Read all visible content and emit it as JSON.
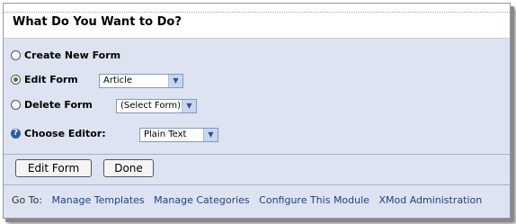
{
  "header": {
    "title": "What Do You Want to Do?"
  },
  "options": {
    "create": {
      "label": "Create New Form",
      "checked": false
    },
    "edit": {
      "label": "Edit Form",
      "checked": true,
      "select_value": "Article"
    },
    "delete": {
      "label": "Delete Form",
      "checked": false,
      "select_value": "(Select Form)"
    },
    "editor": {
      "label": "Choose Editor:",
      "select_value": "Plain Text"
    }
  },
  "buttons": {
    "primary": "Edit Form",
    "done": "Done"
  },
  "footer": {
    "goto_label": "Go To:",
    "links": [
      "Manage Templates",
      "Manage Categories",
      "Configure This Module",
      "XMod Administration"
    ]
  },
  "icons": {
    "help": "help-icon",
    "dropdown": "chevron-down-icon"
  },
  "colors": {
    "panel_bg": "#dde3f0",
    "link": "#1f3f8c",
    "radio_checked": "#2a8a2a"
  }
}
